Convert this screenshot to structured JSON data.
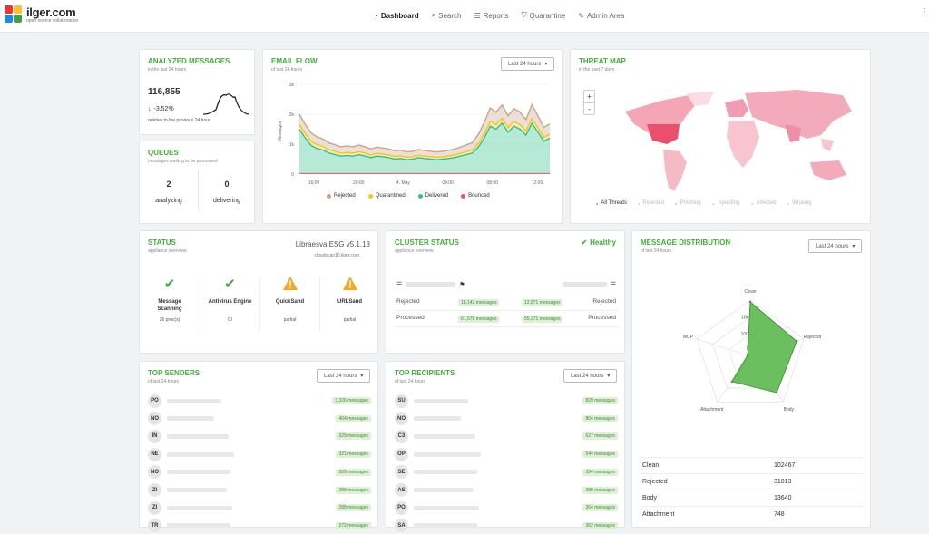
{
  "brand": {
    "name": "ilger.com",
    "tagline": "open source collaboration"
  },
  "nav": {
    "items": [
      {
        "label": "Dashboard",
        "icon": "dashboard-icon",
        "active": true
      },
      {
        "label": "Search",
        "icon": "search-icon"
      },
      {
        "label": "Reports",
        "icon": "list-icon"
      },
      {
        "label": "Quarantine",
        "icon": "shield-icon"
      },
      {
        "label": "Admin Area",
        "icon": "wrench-icon"
      }
    ],
    "more": "⋮"
  },
  "analyzed": {
    "title": "ANALYZED MESSAGES",
    "subtitle": "in the last 24 hours",
    "value": "116,855",
    "change": "-3.52%",
    "note": "relative to the previous 24 hour"
  },
  "queues": {
    "title": "QUEUES",
    "subtitle": "messages waiting to be processed",
    "analyzing_value": "2",
    "analyzing_label": "analyzing",
    "delivering_value": "0",
    "delivering_label": "delivering"
  },
  "email_flow": {
    "title": "EMAIL FLOW",
    "subtitle": "of last 24 hours",
    "range": "Last 24 hours",
    "legend": [
      {
        "label": "Rejected",
        "color": "#c9a48b"
      },
      {
        "label": "Quarantined",
        "color": "#f5c518"
      },
      {
        "label": "Delivered",
        "color": "#2ec28b"
      },
      {
        "label": "Bounced",
        "color": "#e8556b"
      }
    ]
  },
  "chart_data": {
    "type": "area",
    "title": "EMAIL FLOW",
    "ylabel": "Messages",
    "ylim": [
      0,
      3000
    ],
    "yticks": [
      "0",
      "1k",
      "2k",
      "3k"
    ],
    "xticks": [
      "16:00",
      "20:00",
      "4. May",
      "04:00",
      "08:00",
      "12:00"
    ],
    "series": [
      {
        "name": "Delivered",
        "color": "#2ec28b",
        "values": [
          1500,
          1200,
          950,
          850,
          800,
          700,
          650,
          600,
          620,
          600,
          650,
          600,
          550,
          600,
          580,
          550,
          500,
          520,
          480,
          500,
          550,
          520,
          500,
          480,
          500,
          520,
          550,
          600,
          650,
          700,
          900,
          1200,
          1600,
          1500,
          1700,
          1400,
          1600,
          1500,
          1300,
          1700,
          1400,
          1100,
          1200
        ]
      },
      {
        "name": "Quarantined",
        "color": "#f5c518",
        "values": [
          150,
          150,
          140,
          130,
          120,
          110,
          110,
          100,
          100,
          100,
          100,
          100,
          90,
          90,
          90,
          90,
          90,
          90,
          80,
          80,
          80,
          80,
          80,
          80,
          80,
          80,
          90,
          90,
          100,
          100,
          120,
          140,
          160,
          150,
          160,
          150,
          160,
          150,
          140,
          160,
          150,
          130,
          130
        ]
      },
      {
        "name": "Rejected",
        "color": "#c9a48b",
        "values": [
          350,
          300,
          280,
          260,
          250,
          230,
          220,
          210,
          220,
          210,
          220,
          210,
          200,
          210,
          200,
          200,
          190,
          190,
          180,
          180,
          190,
          190,
          180,
          180,
          180,
          190,
          200,
          210,
          230,
          250,
          300,
          380,
          450,
          420,
          450,
          400,
          430,
          420,
          380,
          460,
          400,
          330,
          350
        ]
      },
      {
        "name": "Bounced",
        "color": "#e8556b",
        "values": [
          20,
          20,
          20,
          20,
          20,
          20,
          20,
          20,
          20,
          20,
          20,
          20,
          20,
          20,
          20,
          20,
          20,
          20,
          20,
          20,
          20,
          20,
          20,
          20,
          20,
          20,
          20,
          20,
          20,
          20,
          20,
          20,
          20,
          20,
          20,
          20,
          20,
          20,
          20,
          20,
          20,
          20,
          20
        ]
      }
    ]
  },
  "threat_map": {
    "title": "THREAT MAP",
    "subtitle": "in the past 7 days",
    "zoom_in": "+",
    "zoom_out": "-",
    "legend": [
      "All Threats",
      "Rejected",
      "Phishing",
      "Spoofing",
      "Infected",
      "Whaling"
    ]
  },
  "status": {
    "title": "STATUS",
    "subtitle": "appliance overview",
    "version": "Libraesva ESG v5.1.13",
    "host": "cloudscan10.ilger.com",
    "items": [
      {
        "name": "Message Scanning",
        "detail": "26 proc(s)",
        "state": "ok"
      },
      {
        "name": "Antivirus Engine",
        "detail": "CI",
        "state": "ok"
      },
      {
        "name": "QuickSand",
        "detail": "partial",
        "state": "warn"
      },
      {
        "name": "URLSand",
        "detail": "partial",
        "state": "warn"
      }
    ]
  },
  "cluster": {
    "title": "CLUSTER STATUS",
    "subtitle": "appliance overview",
    "health": "Healthy",
    "rows": [
      {
        "left": "Rejected",
        "a": "18,142 messages",
        "b": "12,871 messages",
        "right": "Rejected"
      },
      {
        "left": "Processed",
        "a": "61,578 messages",
        "b": "55,271 messages",
        "right": "Processed"
      }
    ]
  },
  "distribution": {
    "title": "MESSAGE DISTRIBUTION",
    "subtitle": "of last 24 hours",
    "range": "Last 24 hours",
    "axes": [
      "Clean",
      "Rejected",
      "Body",
      "Attachment",
      "MCP"
    ],
    "scale_labels": [
      "10k",
      "100",
      "1"
    ],
    "table": [
      {
        "label": "Clean",
        "value": "102467"
      },
      {
        "label": "Rejected",
        "value": "31013"
      },
      {
        "label": "Body",
        "value": "13640"
      },
      {
        "label": "Attachment",
        "value": "748"
      }
    ]
  },
  "top_senders": {
    "title": "TOP SENDERS",
    "subtitle": "of last 24 hours",
    "range": "Last 24 hours",
    "rows": [
      {
        "initials": "PO",
        "count": "3,326 messages"
      },
      {
        "initials": "NO",
        "count": "404 messages"
      },
      {
        "initials": "IN",
        "count": "329 messages"
      },
      {
        "initials": "NE",
        "count": "321 messages"
      },
      {
        "initials": "NO",
        "count": "309 messages"
      },
      {
        "initials": "ZI",
        "count": "289 messages"
      },
      {
        "initials": "ZI",
        "count": "288 messages"
      },
      {
        "initials": "TR",
        "count": "272 messages"
      }
    ]
  },
  "top_recipients": {
    "title": "TOP RECIPIENTS",
    "subtitle": "of last 24 hours",
    "range": "Last 24 hours",
    "rows": [
      {
        "initials": "SU",
        "count": "829 messages"
      },
      {
        "initials": "NO",
        "count": "804 messages"
      },
      {
        "initials": "C3",
        "count": "627 messages"
      },
      {
        "initials": "OP",
        "count": "544 messages"
      },
      {
        "initials": "SE",
        "count": "394 messages"
      },
      {
        "initials": "AS",
        "count": "388 messages"
      },
      {
        "initials": "PO",
        "count": "364 messages"
      },
      {
        "initials": "SA",
        "count": "362 messages"
      }
    ]
  }
}
